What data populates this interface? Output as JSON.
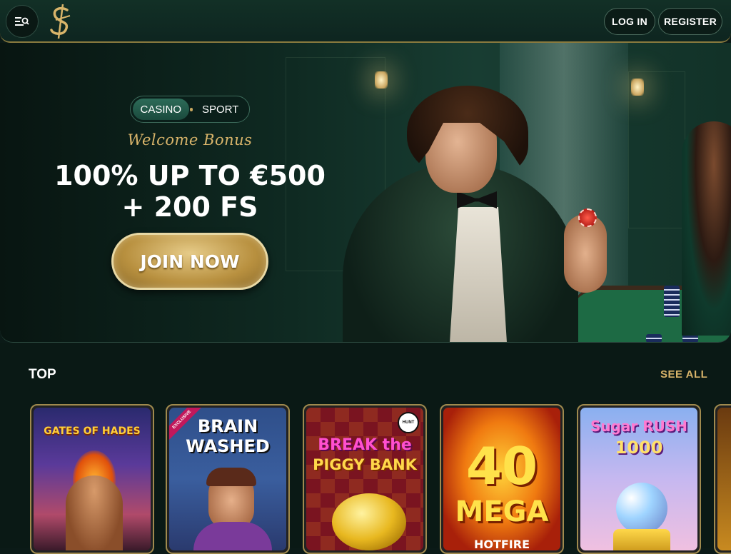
{
  "header": {
    "login_label": "LOG IN",
    "register_label": "REGISTER"
  },
  "hero": {
    "tabs": [
      {
        "label": "CASINO",
        "active": true
      },
      {
        "label": "SPORT",
        "active": false
      }
    ],
    "welcome_label": "Welcome Bonus",
    "bonus_line_1": "100% UP TO €500",
    "bonus_line_2": "+ 200 FS",
    "cta_label": "JOIN NOW"
  },
  "games": {
    "section_title": "TOP",
    "see_all_label": "SEE ALL",
    "items": [
      {
        "title": "GATES OF HADES"
      },
      {
        "title_line_1": "BRAIN",
        "title_line_2": "WASHED",
        "badge": "EXCLUSIVE"
      },
      {
        "title_line_1": "BREAK the",
        "title_line_2": "PIGGY BANK",
        "tag": "HUNT"
      },
      {
        "title_line_1": "40",
        "title_line_2": "MEGA",
        "title_line_3": "HOTFIRE"
      },
      {
        "title_line_1": "Sugar RUSH",
        "title_line_2": "1000"
      }
    ]
  },
  "colors": {
    "accent_gold": "#d8b46a",
    "bg_dark": "#0a1915",
    "header_green": "#123026"
  }
}
